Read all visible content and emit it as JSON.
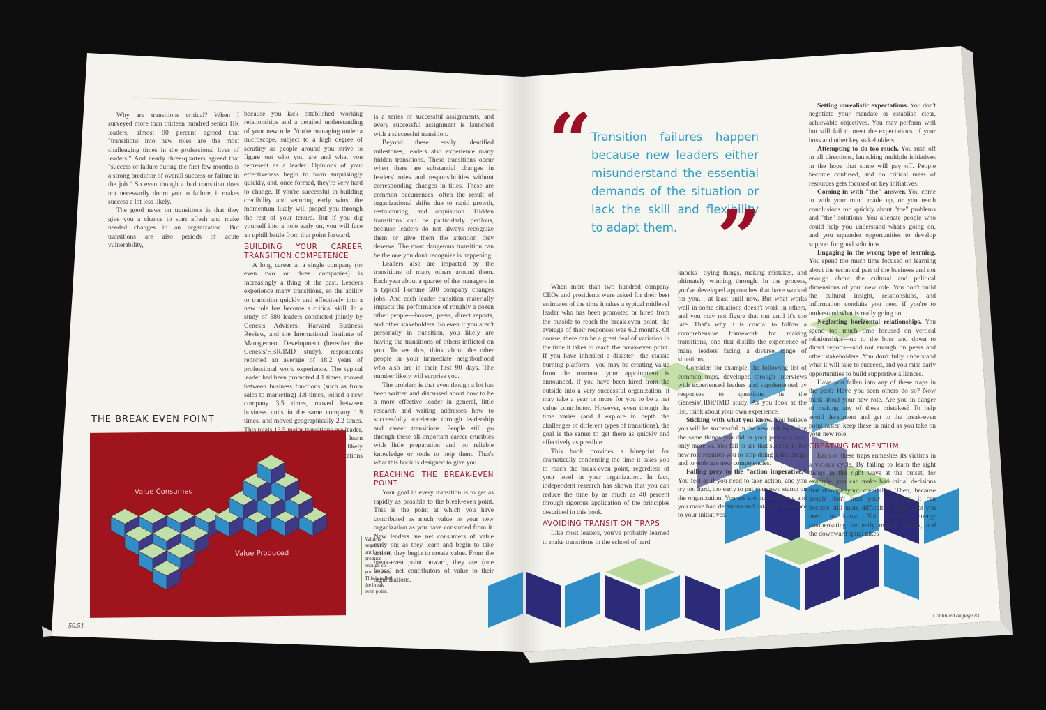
{
  "left_page": {
    "col1": [
      "Why are transitions critical? When I surveyed more than thirteen hundred senior HR leaders, almost 90 percent agreed that \"transitions into new roles are the most challenging times in the professional lives of leaders.\" And nearly three-quarters agreed that \"success or failure during the first few months is a strong predictor of overall success or failure in the job.\" So even though a bad transition does not necessarily doom you to failure, it makes success a lot less likely.",
      "The good news on transitions is that they give you a chance to start afresh and make needed changes in an organization. But transitions are also periods of acute vulnerability,"
    ],
    "col2": [
      "because you lack established working relationships and a detailed understanding of your new role. You're managing under a microscope, subject to a high degree of scrutiny as people around you strive to figure out who you are and what you represent as a leader. Opinions of your effectiveness begin to form surprisingly quickly, and, once formed, they're very hard to change. If you're successful in building credibility and securing early wins, the momentum likely will propel you through the rest of your tenure. But if you dig yourself into a hole early on, you will face an uphill battle from that point forward."
    ],
    "col2_heading": "Building Your Career Transition Competence",
    "col2b": [
      "A long career at a single company (or even two or three companies) is increasingly a thing of the past. Leaders experience many transitions, so the ability to transition quickly and effectively into a new role has become a critical skill. In a study of 580 leaders conducted jointly by Genesis Advisers, Harvard Business Review, and the International Institute of Management Development (hereafter the Genesis/HBR/IMD study), respondents reported an average of 18.2 years of professional work experience. The typical leader had been promoted 4.1 times, moved between business functions (such as from sales to marketing) 1.8 times, joined a new company 3.5 times, moved between business units in the same company 1.9 times, and moved geographically 2.2 times. This totals 13.5 major transitions per leader, or one every 1.3 years. As you will learn later, some of these transitions likely happened in parallel. But the implications are clear: every successful career"
    ],
    "col3": [
      "is a series of successful assignments, and every successful assignment is launched with a successful transition.",
      "Beyond these easily identified milestones, leaders also experience many hidden transitions. These transitions occur when there are substantial changes in leaders' roles and responsibilities without corresponding changes in titles. These are common occurrences, often the result of organizational shifts due to rapid growth, restructuring, and acquisition. Hidden transitions can be particularly perilous, because leaders do not always recognize them or give them the attention they deserve. The most dangerous transition can be the one you don't recognize is happening.",
      "Leaders also are impacted by the transitions of many others around them. Each year about a quarter of the managers in a typical Fortune 500 company changes jobs. And each leader transition materially impacts the performance of roughly a dozen other people—bosses, peers, direct reports, and other stakeholders. So even if you aren't personally in transition, you likely are having the transitions of others inflicted on you. To see this, think about the other people in your immediate neighborhood who also are in their first 90 days. The number likely will surprise you.",
      "The problem is that even though a lot has been written and discussed about how to be a more effective leader in general, little research and writing addresses how to successfully accelerate through leadership and career transitions. People still go through these all-important career crucibles with little preparation and no reliable knowledge or tools to help them. That's what this book is designed to give you."
    ],
    "col3_heading": "Reaching the Break-Even Point",
    "col3b": [
      "Your goal in every transition is to get as rapidly as possible to the break-even point. This is the point at which you have contributed as much value to your new organization as you have consumed from it. New leaders are net consumers of value early on; as they learn and begin to take action, they begin to create value. From the break-even point onward, they are (one hopes) net contributors of value to their organizations."
    ],
    "figure_title": "THE BREAK EVEN POINT",
    "figure_label_consumed": "Value Consumed",
    "figure_label_produced": "Value Produced",
    "sidenote": "Value is negative until you can produce enough so you net zero. This is called the break even point.",
    "page_number": "50.51"
  },
  "right_page": {
    "quote": "Transition failures happen because new leaders either misunderstand the essential demands of the situation or lack the skill and flexibility to adapt them.",
    "col1": [
      "When more than two hundred company CEOs and presidents were asked for their best estimates of the time it takes a typical midlevel leader who has been promoted or hired from the outside to reach the break-even point, the average of their responses was 6.2 months. Of course, there can be a great deal of variation in the time it takes to reach the break-even point. If you have inherited a disaster—the classic burning platform—you may be creating value from the moment your appointment is announced. If you have been hired from the outside into a very successful organization, it may take a year or more for you to be a net value contributor. However, even though the time varies (and I explore in depth the challenges of different types of transitions), the goal is the same: to get there as quickly and effectively as possible.",
      "This book provides a blueprint for dramatically condensing the time it takes you to reach the break-even point, regardless of your level in your organization. In fact, independent research has shown that you can reduce the time by as much as 40 percent through rigorous application of the principles described in this book."
    ],
    "col1_heading": "Avoiding Transition Traps",
    "col1b": [
      "Like most leaders, you've probably learned to make transitions in the school of hard"
    ],
    "col2": [
      "knocks—trying things, making mistakes, and ultimately winning through. In the process, you've developed approaches that have worked for you… at least until now. But what works well in some situations doesn't work in others, and you may not figure that out until it's too late. That's why it is crucial to follow a comprehensive framework for making transitions, one that distills the experience of many leaders facing a diverse range of situations.",
      "Consider, for example, the following list of common traps, developed through interviews with experienced leaders and supplemented by responses to questions in the Genesis/HBR/IMD study. As you look at the list, think about your own experience."
    ],
    "traps_mid": [
      {
        "title": "Sticking with what you know.",
        "text": "You believe you will be successful in the new role by doing the same things you did in your previous role, only more so. You fail to see that success in the new role requires you to stop doing some things and to embrace new competencies."
      },
      {
        "title": "Falling prey to the \"action imperative.\"",
        "text": "You feel as if you need to take action, and you try too hard, too early to put your own stamp on the organization. You are too busy to learn, and you make bad decisions and catalyze resistance to your initiatives."
      }
    ],
    "traps_right": [
      {
        "title": "Setting unrealistic expectations.",
        "text": "You don't negotiate your mandate or establish clear, achievable objectives. You may perform well but still fail to meet the expectations of your boss and other key stakeholders."
      },
      {
        "title": "Attempting to do too much.",
        "text": "You rush off in all directions, launching multiple initiatives in the hope that some will pay off. People become confused, and no critical mass of resources gets focused on key initiatives."
      },
      {
        "title": "Coming in with \"the\" answer.",
        "text": "You come in with your mind made up, or you reach conclusions too quickly about \"the\" problems and \"the\" solutions. You alienate people who could help you understand what's going on, and you squander opportunities to develop support for good solutions."
      },
      {
        "title": "Engaging in the wrong type of learning.",
        "text": "You spend too much time focused on learning about the technical part of the business and not enough about the cultural and political dimensions of your new role. You don't build the cultural insight, relationships, and information conduits you need if you're to understand what is really going on."
      },
      {
        "title": "Neglecting horizontal relationships.",
        "text": "You spend too much time focused on vertical relationships—up to the boss and down to direct reports—and not enough on peers and other stakeholders. You don't fully understand what it will take to succeed, and you miss early opportunities to build supportive alliances."
      }
    ],
    "col3_tail": "Have you fallen into any of these traps in the past? Have you seen others do so? Now think about your new role. Are you in danger of making any of these mistakes? To help avoid derailment and get to the break-even point faster, keep these in mind as you take on your new role.",
    "col3_heading": "Creating Momentum",
    "col3b": "Each of these traps enmeshes its victims in a vicious cycle. By failing to learn the right things in the right ways at the outset, for example, you can make bad initial decisions that damage your credibility. Then, because people don't trust your judgment, it can become still more difficult to learn what you need to know. You consume energy compensating for early miscalculations, and the downward spiral takes",
    "continued": "Continued on page 83"
  },
  "colors": {
    "accent_red": "#a3182a",
    "quote_blue": "#2a9ec7",
    "figure_red": "#a0151d",
    "cube_green": "#b9d99a",
    "cube_blue": "#2f8ec7",
    "cube_navy": "#2c2b7a"
  }
}
